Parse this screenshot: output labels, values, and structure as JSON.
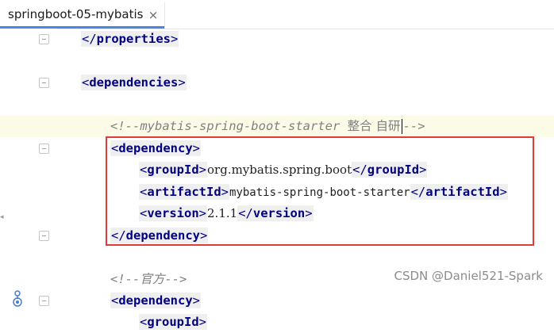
{
  "tab": {
    "title": "springboot-05-mybatis",
    "close": "×"
  },
  "colors": {
    "tag": "#000080",
    "comment": "#808080",
    "tag_bg": "#efefef",
    "current_line": "#fcfbe8",
    "highlight_box": "#e53935",
    "tab_active": "#4a86e8"
  },
  "code": {
    "properties_close": "properties",
    "dependencies_open": "dependencies",
    "comment1_a": "<!--mybatis-spring-boot-starter ",
    "comment1_b": "整合 自研",
    "comment1_c": "-->",
    "dep1": {
      "open": "dependency",
      "groupId_tag": "groupId",
      "groupId": "org.mybatis.spring.boot",
      "artifactId_tag": "artifactId",
      "artifactId": "mybatis-spring-boot-starter",
      "version_tag": "version",
      "version": "2.1.1",
      "close": "dependency"
    },
    "comment2": "<!--官方-->",
    "dep2_open": "dependency",
    "partial_tag": "groupId"
  },
  "gutter_icon": "maven-dependency-icon",
  "watermark": "CSDN @Daniel521-Spark"
}
